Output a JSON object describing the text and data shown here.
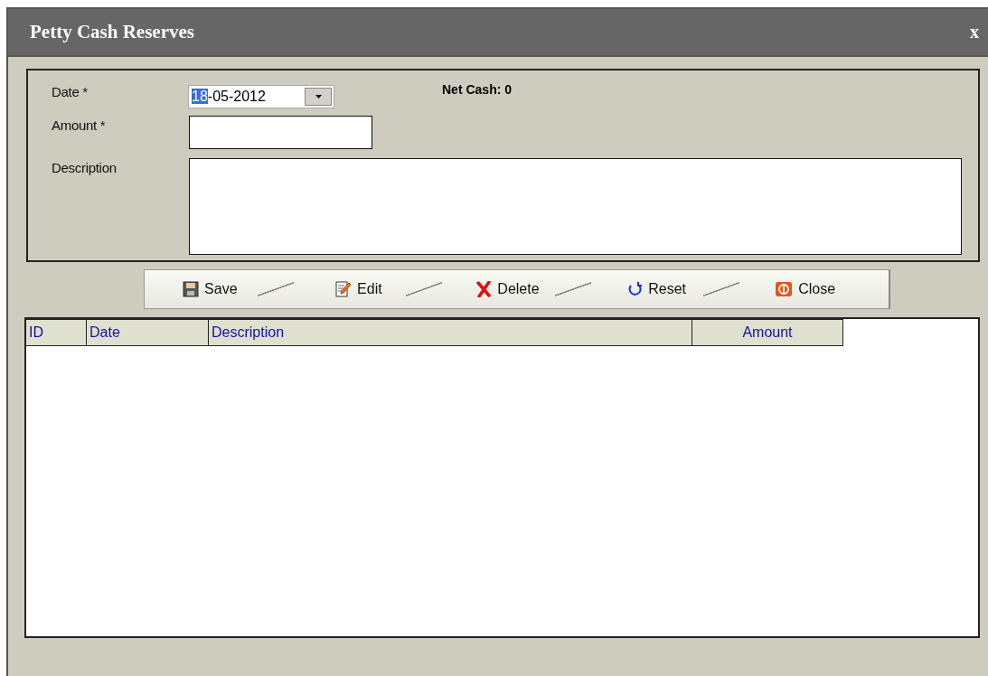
{
  "window": {
    "title": "Petty Cash Reserves",
    "close": "x"
  },
  "form": {
    "fields": [
      {
        "kind": "date",
        "label": "Date *",
        "parts": [
          {
            "text": "18",
            "selected": true
          },
          {
            "text": "-05-2012",
            "selected": false
          }
        ]
      },
      {
        "kind": "text",
        "label": "Amount *"
      },
      {
        "kind": "textarea",
        "label": "Description"
      }
    ],
    "net_cash": "Net Cash: 0"
  },
  "toolbar": [
    {
      "kind": "save",
      "label": "Save"
    },
    {
      "kind": "edit",
      "label": "Edit"
    },
    {
      "kind": "delete",
      "label": "Delete"
    },
    {
      "kind": "reset",
      "label": "Reset"
    },
    {
      "kind": "close",
      "label": "Close"
    }
  ],
  "table": {
    "columns": [
      "ID",
      "Date",
      "Description",
      "Amount"
    ]
  }
}
